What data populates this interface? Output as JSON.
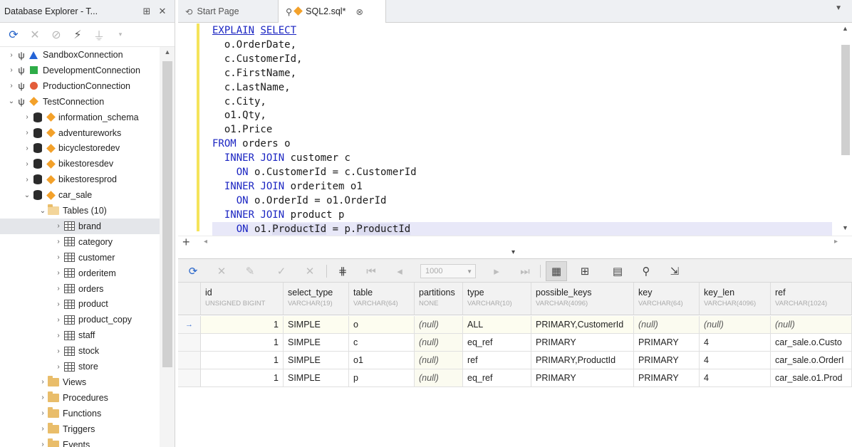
{
  "sidebar": {
    "title": "Database Explorer - T...",
    "tree": [
      {
        "label": "SandboxConnection",
        "icon": "blue-triangle-icon"
      },
      {
        "label": "DevelopmentConnection",
        "icon": "green-square-icon"
      },
      {
        "label": "ProductionConnection",
        "icon": "red-circle-icon"
      },
      {
        "label": "TestConnection",
        "icon": "orange-diamond-icon"
      },
      {
        "label": "information_schema",
        "icon": "database-icon"
      },
      {
        "label": "adventureworks",
        "icon": "database-icon"
      },
      {
        "label": "bicyclestoredev",
        "icon": "database-icon"
      },
      {
        "label": "bikestoresdev",
        "icon": "database-icon"
      },
      {
        "label": "bikestoresprod",
        "icon": "database-icon"
      },
      {
        "label": "car_sale",
        "icon": "database-icon"
      },
      {
        "label": "Tables (10)",
        "icon": "folder-icon"
      },
      {
        "label": "brand",
        "icon": "table-icon"
      },
      {
        "label": "category",
        "icon": "table-icon"
      },
      {
        "label": "customer",
        "icon": "table-icon"
      },
      {
        "label": "orderitem",
        "icon": "table-icon"
      },
      {
        "label": "orders",
        "icon": "table-icon"
      },
      {
        "label": "product",
        "icon": "table-icon"
      },
      {
        "label": "product_copy",
        "icon": "table-icon"
      },
      {
        "label": "staff",
        "icon": "table-icon"
      },
      {
        "label": "stock",
        "icon": "table-icon"
      },
      {
        "label": "store",
        "icon": "table-icon"
      },
      {
        "label": "Views",
        "icon": "folder-icon"
      },
      {
        "label": "Procedures",
        "icon": "folder-icon"
      },
      {
        "label": "Functions",
        "icon": "folder-icon"
      },
      {
        "label": "Triggers",
        "icon": "folder-icon"
      },
      {
        "label": "Events",
        "icon": "folder-icon"
      }
    ]
  },
  "tabs": [
    {
      "label": "Start Page",
      "active": false
    },
    {
      "label": "SQL2.sql*",
      "active": true
    }
  ],
  "editor": {
    "lines": [
      "EXPLAIN SELECT",
      "  o.OrderDate,",
      "  c.CustomerId,",
      "  c.FirstName,",
      "  c.LastName,",
      "  c.City,",
      "  o1.Qty,",
      "  o1.Price",
      "FROM orders o",
      "  INNER JOIN customer c",
      "    ON o.CustomerId = c.CustomerId",
      "  INNER JOIN orderitem o1",
      "    ON o.OrderId = o1.OrderId",
      "  INNER JOIN product p",
      "    ON o1.ProductId = p.ProductId"
    ]
  },
  "results": {
    "page_size": "1000",
    "columns": [
      {
        "name": "id",
        "type": "UNSIGNED BIGINT"
      },
      {
        "name": "select_type",
        "type": "VARCHAR(19)"
      },
      {
        "name": "table",
        "type": "VARCHAR(64)"
      },
      {
        "name": "partitions",
        "type": "NONE"
      },
      {
        "name": "type",
        "type": "VARCHAR(10)"
      },
      {
        "name": "possible_keys",
        "type": "VARCHAR(4096)"
      },
      {
        "name": "key",
        "type": "VARCHAR(64)"
      },
      {
        "name": "key_len",
        "type": "VARCHAR(4096)"
      },
      {
        "name": "ref",
        "type": "VARCHAR(1024)"
      }
    ],
    "rows": [
      [
        "1",
        "SIMPLE",
        "o",
        "(null)",
        "ALL",
        "PRIMARY,CustomerId",
        "(null)",
        "(null)",
        "(null)"
      ],
      [
        "1",
        "SIMPLE",
        "c",
        "(null)",
        "eq_ref",
        "PRIMARY",
        "PRIMARY",
        "4",
        "car_sale.o.Custo"
      ],
      [
        "1",
        "SIMPLE",
        "o1",
        "(null)",
        "ref",
        "PRIMARY,ProductId",
        "PRIMARY",
        "4",
        "car_sale.o.OrderI"
      ],
      [
        "1",
        "SIMPLE",
        "p",
        "(null)",
        "eq_ref",
        "PRIMARY",
        "PRIMARY",
        "4",
        "car_sale.o1.Prod"
      ]
    ]
  }
}
